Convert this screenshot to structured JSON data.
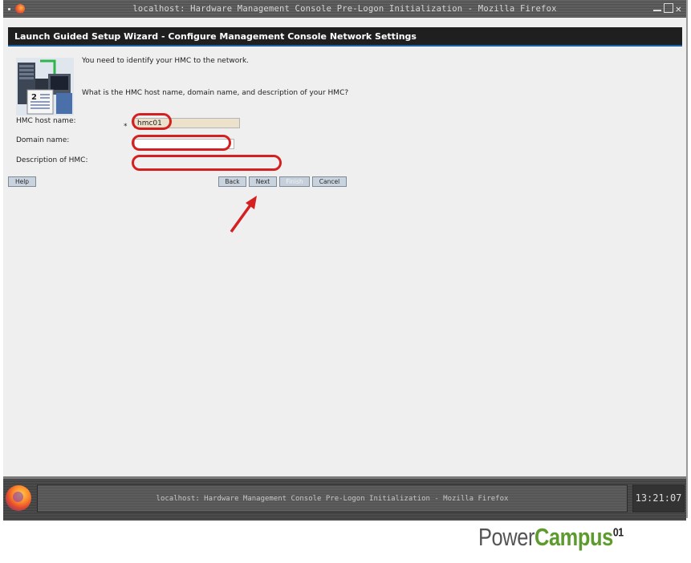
{
  "window": {
    "title": "localhost: Hardware Management Console Pre-Logon Initialization - Mozilla Firefox"
  },
  "wizard": {
    "header": "Launch Guided Setup Wizard - Configure Management Console Network Settings",
    "icon_badge": "2",
    "message_1": "You need to identify your HMC to the network.",
    "message_2": "What is the HMC host name, domain name, and description of your HMC?",
    "fields": {
      "host_label": "HMC host name:",
      "required_marker": "*",
      "host_value": "hmc01",
      "domain_label": "Domain name:",
      "domain_value": "",
      "description_label": "Description of HMC:",
      "description_value": ""
    },
    "buttons": {
      "help": "Help",
      "back": "Back",
      "next": "Next",
      "finish": "Finish",
      "cancel": "Cancel"
    }
  },
  "annotation": {
    "color": "#d42020"
  },
  "taskbar": {
    "task_title": "localhost: Hardware Management Console Pre-Logon Initialization - Mozilla Firefox",
    "clock": "13:21:07"
  },
  "watermark": {
    "part1": "Power",
    "part2": "Campus",
    "superscript": "01"
  }
}
